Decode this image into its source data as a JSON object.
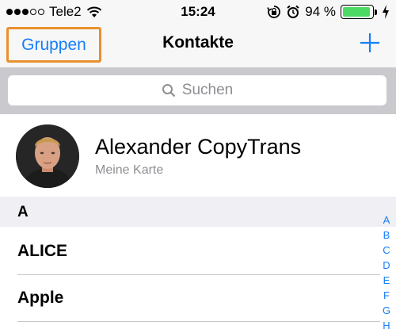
{
  "status_bar": {
    "carrier": "Tele2",
    "time": "15:24",
    "battery_text": "94 %",
    "battery_level": 0.94,
    "signal_bars": 3,
    "signal_total": 5
  },
  "nav": {
    "groups_label": "Gruppen",
    "title": "Kontakte"
  },
  "search": {
    "placeholder": "Suchen"
  },
  "my_card": {
    "name": "Alexander CopyTrans",
    "subtitle": "Meine Karte"
  },
  "section": {
    "letter": "A"
  },
  "contacts": [
    "ALICE",
    "Apple"
  ],
  "index_letters": [
    "A",
    "B",
    "C",
    "D",
    "E",
    "F",
    "G",
    "H"
  ],
  "colors": {
    "accent": "#157efb",
    "highlight": "#e8912d",
    "battery": "#4cd964"
  }
}
